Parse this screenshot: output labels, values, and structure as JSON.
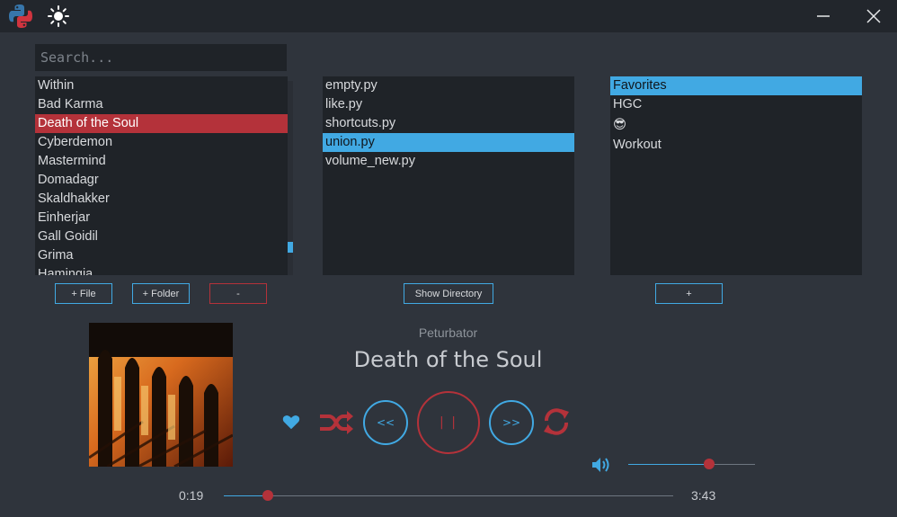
{
  "titlebar": {
    "logo_icon": "python-logo",
    "theme_icon": "sun-icon",
    "minimize_icon": "minimize-icon",
    "close_icon": "close-icon"
  },
  "search": {
    "placeholder": "Search...",
    "value": ""
  },
  "songs": {
    "items": [
      "Within",
      "Bad Karma",
      "Death of the Soul",
      "Cyberdemon",
      "Mastermind",
      "Domadagr",
      "Skaldhakker",
      "Einherjar",
      "Gall Goidil",
      "Grima",
      "Hamingja"
    ],
    "selected": "Death of the Soul"
  },
  "scripts": {
    "items": [
      "empty.py",
      "like.py",
      "shortcuts.py",
      "union.py",
      "volume_new.py"
    ],
    "selected": "union.py"
  },
  "playlists": {
    "items": [
      "Favorites",
      "HGC",
      "😎",
      "Workout"
    ],
    "selected": "Favorites"
  },
  "buttons": {
    "add_file": "+ File",
    "add_folder": "+ Folder",
    "remove": "-",
    "show_directory": "Show Directory",
    "add_playlist": "+"
  },
  "now_playing": {
    "artist": "Peturbator",
    "title": "Death of the Soul",
    "elapsed": "0:19",
    "duration": "3:43",
    "progress_fraction": 0.097,
    "volume_fraction": 0.64
  },
  "controls": {
    "prev_label": "<<",
    "play_label": "| |",
    "next_label": ">>",
    "like_icon": "heart-icon",
    "shuffle_icon": "shuffle-icon",
    "repeat_icon": "repeat-icon",
    "volume_icon": "speaker-icon"
  },
  "colors": {
    "accent_blue": "#41a9e3",
    "accent_red": "#b4323a",
    "background": "#2f343c",
    "panel": "#1f2328"
  }
}
